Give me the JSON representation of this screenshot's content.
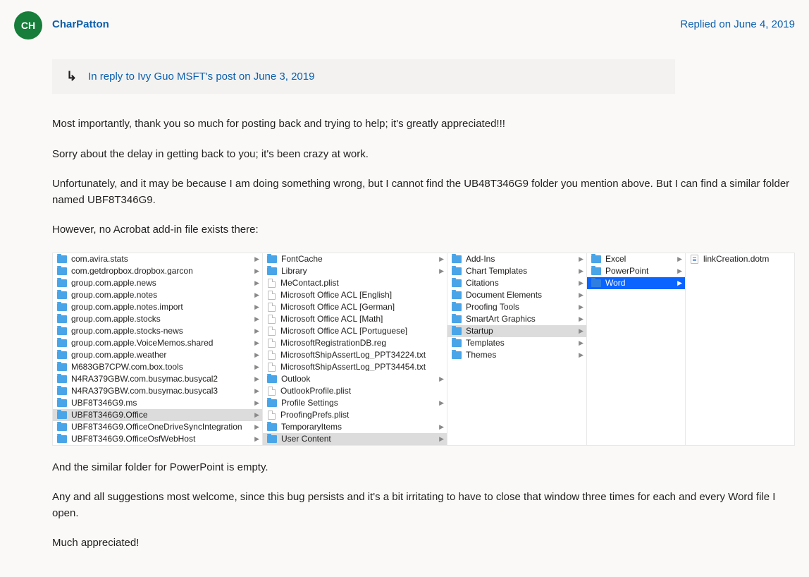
{
  "post": {
    "avatar_initials": "CH",
    "author": "CharPatton",
    "reply_date": "Replied on June 4, 2019",
    "reply_to_text": "In reply to Ivy Guo MSFT's post on June 3, 2019",
    "paragraphs": {
      "p1": "Most importantly, thank you so much for posting back and trying to help; it's greatly appreciated!!!",
      "p2": "Sorry about the delay in getting back to you; it's been crazy at work.",
      "p3": "Unfortunately, and it may be because I am doing something wrong, but I cannot find the UB48T346G9 folder you mention above. But I can find a similar folder named UBF8T346G9.",
      "p4": "However, no Acrobat add-in file exists there:",
      "p5": "And the similar folder for PowerPoint is empty.",
      "p6": "Any and all suggestions most welcome, since this bug persists and it's a bit irritating to have to close that window three times for each and every Word file I open.",
      "p7": "Much appreciated!"
    }
  },
  "finder": {
    "col0": [
      {
        "type": "folder",
        "name": "com.avira.stats",
        "arrow": true
      },
      {
        "type": "folder",
        "name": "com.getdropbox.dropbox.garcon",
        "arrow": true
      },
      {
        "type": "folder",
        "name": "group.com.apple.news",
        "arrow": true
      },
      {
        "type": "folder",
        "name": "group.com.apple.notes",
        "arrow": true
      },
      {
        "type": "folder",
        "name": "group.com.apple.notes.import",
        "arrow": true
      },
      {
        "type": "folder",
        "name": "group.com.apple.stocks",
        "arrow": true
      },
      {
        "type": "folder",
        "name": "group.com.apple.stocks-news",
        "arrow": true
      },
      {
        "type": "folder",
        "name": "group.com.apple.VoiceMemos.shared",
        "arrow": true
      },
      {
        "type": "folder",
        "name": "group.com.apple.weather",
        "arrow": true
      },
      {
        "type": "folder",
        "name": "M683GB7CPW.com.box.tools",
        "arrow": true
      },
      {
        "type": "folder",
        "name": "N4RA379GBW.com.busymac.busycal2",
        "arrow": true
      },
      {
        "type": "folder",
        "name": "N4RA379GBW.com.busymac.busycal3",
        "arrow": true
      },
      {
        "type": "folder",
        "name": "UBF8T346G9.ms",
        "arrow": true
      },
      {
        "type": "folder",
        "name": "UBF8T346G9.Office",
        "arrow": true,
        "selected": true
      },
      {
        "type": "folder",
        "name": "UBF8T346G9.OfficeOneDriveSyncIntegration",
        "arrow": true
      },
      {
        "type": "folder",
        "name": "UBF8T346G9.OfficeOsfWebHost",
        "arrow": true
      }
    ],
    "col1": [
      {
        "type": "folder",
        "name": "FontCache",
        "arrow": true
      },
      {
        "type": "folder",
        "name": "Library",
        "arrow": true
      },
      {
        "type": "file",
        "name": "MeContact.plist"
      },
      {
        "type": "file",
        "name": "Microsoft Office ACL [English]"
      },
      {
        "type": "file",
        "name": "Microsoft Office ACL [German]"
      },
      {
        "type": "file",
        "name": "Microsoft Office ACL [Math]"
      },
      {
        "type": "file",
        "name": "Microsoft Office ACL [Portuguese]"
      },
      {
        "type": "file",
        "name": "MicrosoftRegistrationDB.reg"
      },
      {
        "type": "file",
        "name": "MicrosoftShipAssertLog_PPT34224.txt"
      },
      {
        "type": "file",
        "name": "MicrosoftShipAssertLog_PPT34454.txt"
      },
      {
        "type": "folder",
        "name": "Outlook",
        "arrow": true
      },
      {
        "type": "file",
        "name": "OutlookProfile.plist"
      },
      {
        "type": "folder",
        "name": "Profile Settings",
        "arrow": true
      },
      {
        "type": "file",
        "name": "ProofingPrefs.plist"
      },
      {
        "type": "folder",
        "name": "TemporaryItems",
        "arrow": true
      },
      {
        "type": "folder",
        "name": "User Content",
        "arrow": true,
        "selected": true
      }
    ],
    "col2": [
      {
        "type": "folder",
        "name": "Add-Ins",
        "arrow": true
      },
      {
        "type": "folder",
        "name": "Chart Templates",
        "arrow": true
      },
      {
        "type": "folder",
        "name": "Citations",
        "arrow": true
      },
      {
        "type": "folder",
        "name": "Document Elements",
        "arrow": true
      },
      {
        "type": "folder",
        "name": "Proofing Tools",
        "arrow": true
      },
      {
        "type": "folder",
        "name": "SmartArt Graphics",
        "arrow": true
      },
      {
        "type": "folder",
        "name": "Startup",
        "arrow": true,
        "selected": true
      },
      {
        "type": "folder",
        "name": "Templates",
        "arrow": true
      },
      {
        "type": "folder",
        "name": "Themes",
        "arrow": true
      }
    ],
    "col3": [
      {
        "type": "folder",
        "name": "Excel",
        "arrow": true
      },
      {
        "type": "folder",
        "name": "PowerPoint",
        "arrow": true
      },
      {
        "type": "folder",
        "name": "Word",
        "arrow": true,
        "active": true
      }
    ],
    "col4": [
      {
        "type": "doc",
        "name": "linkCreation.dotm"
      }
    ]
  }
}
